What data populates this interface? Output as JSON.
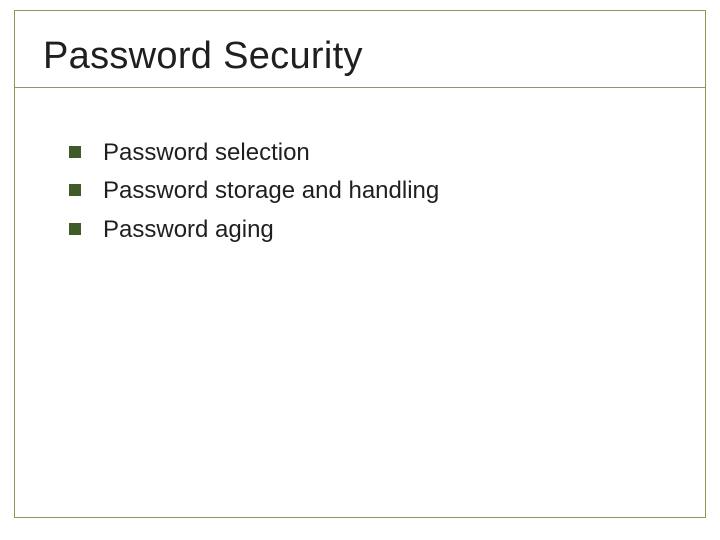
{
  "slide": {
    "title": "Password Security",
    "bullets": [
      {
        "text": "Password selection"
      },
      {
        "text": "Password storage and handling"
      },
      {
        "text": "Password aging"
      }
    ]
  }
}
